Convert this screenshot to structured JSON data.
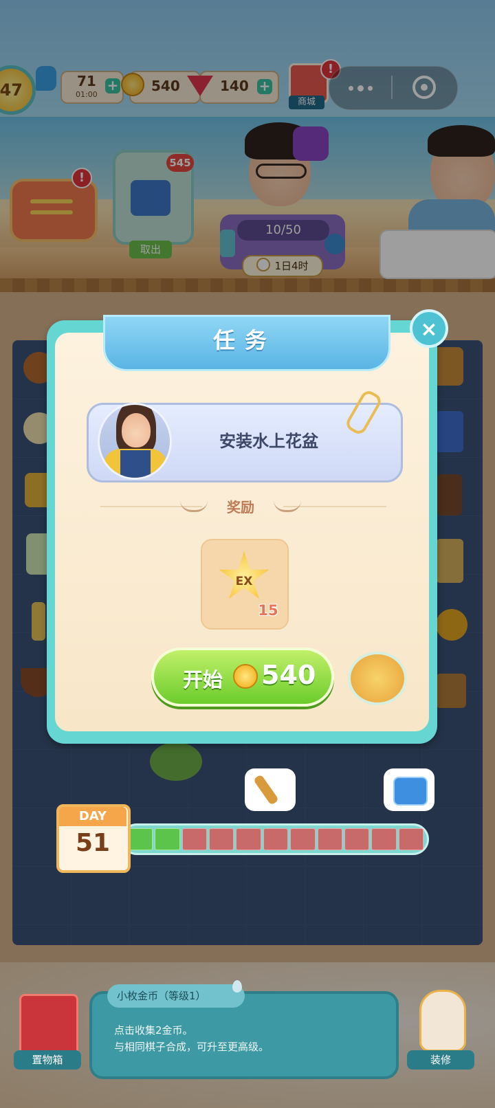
{
  "hud": {
    "level": "47",
    "energy": "71",
    "energy_timer": "01:00",
    "coins": "540",
    "gems": "140",
    "shop_label": "商城",
    "plus": "+",
    "alert": "!"
  },
  "pantry": {
    "count": "545",
    "button_label": "取出"
  },
  "order": {
    "progress": "10/50",
    "timer": "1日4时"
  },
  "task_dialog": {
    "title": "任务",
    "task_name": "安装水上花盆",
    "reward_label": "奖励",
    "reward_item": "EX",
    "reward_qty": "15",
    "start_label": "开始",
    "start_price": "540",
    "close_symbol": "×"
  },
  "day_bar": {
    "day_label": "DAY",
    "day_number": "51",
    "cells_total": 11,
    "cells_filled": 2
  },
  "item_info": {
    "title": "小枚金币（等级1）",
    "line1": "点击收集2金币。",
    "line2": "与相同棋子合成，可升至更高级。"
  },
  "bottom": {
    "storage_label": "置物箱",
    "decorate_label": "装修"
  },
  "colors": {
    "accent_teal": "#66d6d3",
    "start_green": "#6ccc2b",
    "progress_filled": "#5cc44b",
    "progress_empty": "#c96a6a"
  }
}
